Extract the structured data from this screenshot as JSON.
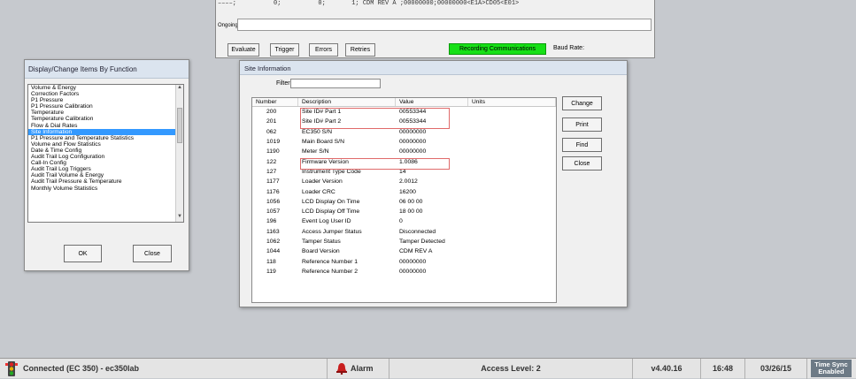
{
  "top_window": {
    "row1_text": "––––;          0;          0;       1; CDM REV A ;00000000;00000000<E1A>CD05<E01>",
    "label_upper": "",
    "ongoing_label": "Ongoing",
    "buttons": [
      "Evaluate",
      "Trigger",
      "Errors",
      "Retries"
    ],
    "recording_status": "Recording Communications",
    "baud_label": "Baud Rate:"
  },
  "left_dialog": {
    "title": "Display/Change Items By Function",
    "items": [
      "Volume & Energy",
      "Correction Factors",
      "P1 Pressure",
      "P1 Pressure Calibration",
      "Temperature",
      "Temperature Calibration",
      "Flow & Dial Rates",
      "Site Information",
      "P1 Pressure and Temperature Statistics",
      "Volume and Flow Statistics",
      "Date & Time Config",
      "Audit Trail Log Configuration",
      "Call-In Config",
      "Audit Trail Log Triggers",
      "Audit Trail Volume & Energy",
      "Audit Trail Pressure & Temperature",
      "Monthly Volume Statistics"
    ],
    "selected_index": 7,
    "ok_label": "OK",
    "close_label": "Close"
  },
  "site_dialog": {
    "title": "Site Information",
    "filter_label": "Filter:",
    "filter_value": "",
    "columns": [
      "Number",
      "Description",
      "Value",
      "Units"
    ],
    "rows": [
      [
        "200",
        "Site ID# Part 1",
        "00553344",
        ""
      ],
      [
        "201",
        "Site ID# Part 2",
        "00553344",
        ""
      ],
      [
        "062",
        "EC350 S/N",
        "00000000",
        ""
      ],
      [
        "1019",
        "Main Board S/N",
        "00000000",
        ""
      ],
      [
        "1190",
        "Meter S/N",
        "00000000",
        ""
      ],
      [
        "122",
        "Firmware Version",
        "1.0086",
        ""
      ],
      [
        "127",
        "Instrument Type Code",
        "14",
        ""
      ],
      [
        "1177",
        "Loader Version",
        "2.0012",
        ""
      ],
      [
        "1176",
        "Loader CRC",
        "16200",
        ""
      ],
      [
        "1056",
        "LCD Display On Time",
        "06 00 00",
        ""
      ],
      [
        "1057",
        "LCD Display Off Time",
        "18 00 00",
        ""
      ],
      [
        "196",
        "Event Log User ID",
        "0",
        ""
      ],
      [
        "1163",
        "Access Jumper Status",
        "Disconnected",
        ""
      ],
      [
        "1062",
        "Tamper Status",
        "Tamper Detected",
        ""
      ],
      [
        "1044",
        "Board Version",
        "CDM REV A",
        ""
      ],
      [
        "118",
        "Reference Number 1",
        "00000000",
        ""
      ],
      [
        "119",
        "Reference Number 2",
        "00000000",
        ""
      ]
    ],
    "buttons": [
      "Change",
      "Print",
      "Find",
      "Close"
    ]
  },
  "status_bar": {
    "connection": "Connected (EC 350) - ec350lab",
    "alarm": "Alarm",
    "access_level": "Access Level: 2",
    "version": "v4.40.16",
    "time": "16:48",
    "date": "03/26/15",
    "timesync_line1": "Time Sync",
    "timesync_line2": "Enabled"
  },
  "colors": {
    "recording_green": "#17e017",
    "selection_blue": "#3399ff",
    "highlight_red": "#e06a6a",
    "timesync_bg": "#6d7a86"
  },
  "icons": {
    "connection": "traffic-light-icon",
    "alarm": "alarm-bell-icon"
  }
}
